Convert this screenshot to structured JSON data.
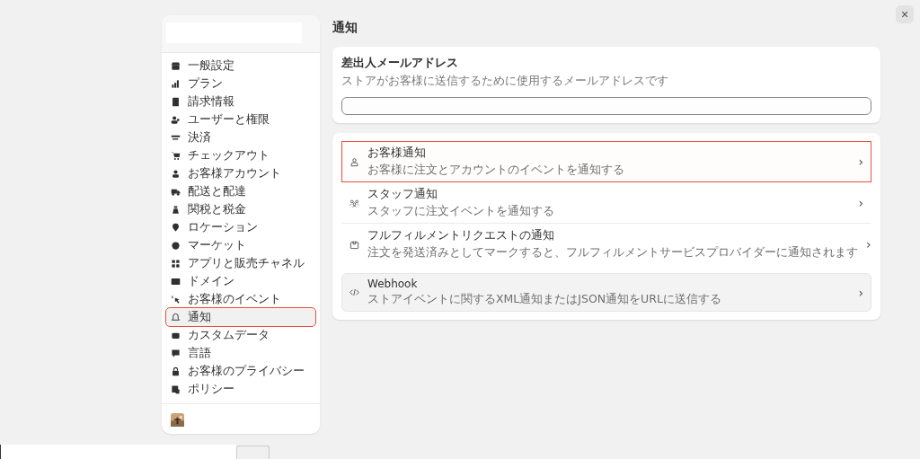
{
  "close_button": {
    "label": "×"
  },
  "sidebar": {
    "items": [
      {
        "label": "一般設定",
        "selected": false
      },
      {
        "label": "プラン",
        "selected": false
      },
      {
        "label": "請求情報",
        "selected": false
      },
      {
        "label": "ユーザーと権限",
        "selected": false
      },
      {
        "label": "決済",
        "selected": false
      },
      {
        "label": "チェックアウト",
        "selected": false
      },
      {
        "label": "お客様アカウント",
        "selected": false
      },
      {
        "label": "配送と配達",
        "selected": false
      },
      {
        "label": "関税と税金",
        "selected": false
      },
      {
        "label": "ロケーション",
        "selected": false
      },
      {
        "label": "マーケット",
        "selected": false
      },
      {
        "label": "アプリと販売チャネル",
        "selected": false
      },
      {
        "label": "ドメイン",
        "selected": false
      },
      {
        "label": "お客様のイベント",
        "selected": false
      },
      {
        "label": "通知",
        "selected": true
      },
      {
        "label": "カスタムデータ",
        "selected": false
      },
      {
        "label": "言語",
        "selected": false
      },
      {
        "label": "お客様のプライバシー",
        "selected": false
      },
      {
        "label": "ポリシー",
        "selected": false
      }
    ]
  },
  "page_title": "通知",
  "sender_card": {
    "title": "差出人メールアドレス",
    "description": "ストアがお客様に送信するために使用するメールアドレスです"
  },
  "notification_rows": [
    {
      "title": "お客様通知",
      "description": "お客様に注文とアカウントのイベントを通知する",
      "highlighted": true,
      "chevron": "›"
    },
    {
      "title": "スタッフ通知",
      "description": "スタッフに注文イベントを通知する",
      "highlighted": false,
      "chevron": "›"
    },
    {
      "title": "フルフィルメントリクエストの通知",
      "description": "注文を発送済みとしてマークすると、フルフィルメントサービスプロバイダーに通知されます",
      "highlighted": false,
      "chevron": "›"
    }
  ],
  "webhook_row": {
    "title": "Webhook",
    "description": "ストアイベントに関するXML通知またはJSON通知をURLに送信する",
    "chevron": "›"
  }
}
